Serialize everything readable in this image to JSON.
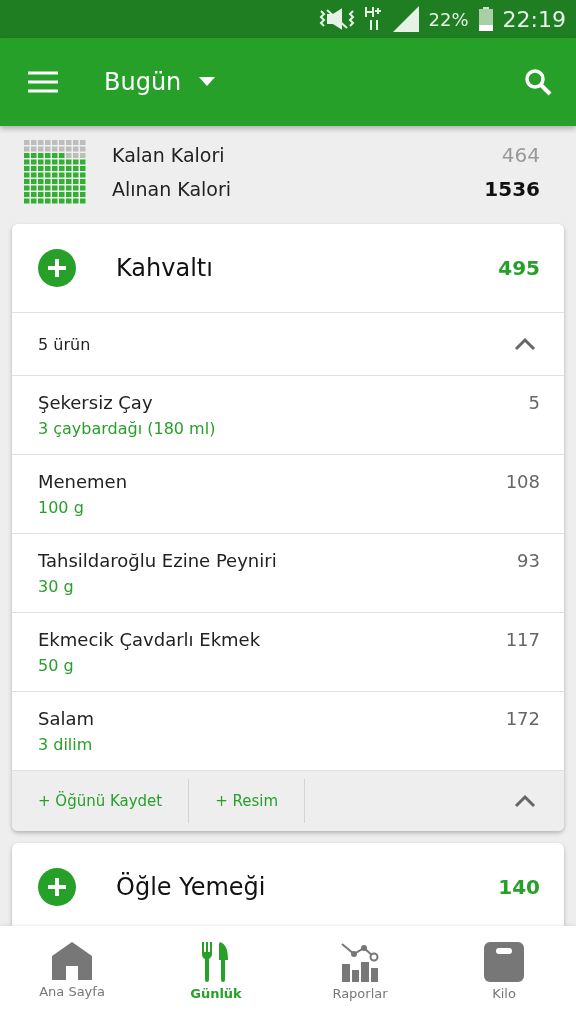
{
  "status_bar": {
    "battery": "22%",
    "time": "22:19"
  },
  "app_bar": {
    "title": "Bugün"
  },
  "summary": {
    "rows": [
      {
        "label": "Kalan Kalori",
        "value": "464",
        "kind": "remaining"
      },
      {
        "label": "Alınan Kalori",
        "value": "1536",
        "kind": "taken"
      }
    ]
  },
  "meals": [
    {
      "title": "Kahvaltı",
      "calories": "495",
      "count": "5 ürün",
      "items": [
        {
          "name": "Şekersiz Çay",
          "portion": "3 çaybardağı (180 ml)",
          "calories": "5"
        },
        {
          "name": "Menemen",
          "portion": "100 g",
          "calories": "108"
        },
        {
          "name": "Tahsildaroğlu Ezine Peyniri",
          "portion": "30 g",
          "calories": "93"
        },
        {
          "name": "Ekmecik Çavdarlı Ekmek",
          "portion": "50 g",
          "calories": "117"
        },
        {
          "name": "Salam",
          "portion": "3 dilim",
          "calories": "172"
        }
      ],
      "actions": [
        "+ Öğünü Kaydet",
        "+ Resim"
      ]
    },
    {
      "title": "Öğle Yemeği",
      "calories": "140"
    }
  ],
  "bottom_nav": [
    {
      "label": "Ana Sayfa",
      "selected": false
    },
    {
      "label": "Günlük",
      "selected": true
    },
    {
      "label": "Raporlar",
      "selected": false
    },
    {
      "label": "Kilo",
      "selected": false
    }
  ]
}
